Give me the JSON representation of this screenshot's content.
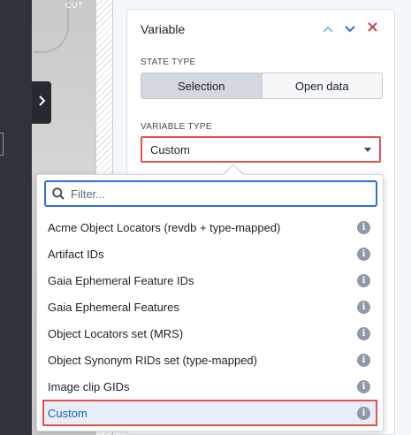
{
  "map": {
    "label": "CUT"
  },
  "panel": {
    "title": "Variable",
    "state_type": {
      "label": "STATE TYPE",
      "options": [
        "Selection",
        "Open data"
      ],
      "selected": "Selection"
    },
    "variable_type": {
      "label": "VARIABLE TYPE",
      "value": "Custom"
    }
  },
  "dropdown": {
    "filter_placeholder": "Filter...",
    "items": [
      {
        "label": "Acme Object Locators (revdb + type-mapped)",
        "info": "i"
      },
      {
        "label": "Artifact IDs",
        "info": "i"
      },
      {
        "label": "Gaia Ephemeral Feature IDs",
        "info": "i"
      },
      {
        "label": "Gaia Ephemeral Features",
        "info": "i"
      },
      {
        "label": "Object Locators set (MRS)",
        "info": "i"
      },
      {
        "label": "Object Synonym RIDs set (type-mapped)",
        "info": "i"
      },
      {
        "label": "Image clip GIDs",
        "info": "i"
      },
      {
        "label": "Custom",
        "info": "i"
      }
    ],
    "selected_index": 7
  },
  "colors": {
    "accent": "#2d72d2",
    "highlight_border": "#e5534b",
    "close": "#cd4246",
    "selected_bg": "#e7eef9"
  },
  "icons": {
    "collapse": "chevron-right-icon",
    "up": "chevron-up-icon",
    "down": "chevron-down-icon",
    "close": "close-icon",
    "search": "search-icon",
    "info": "info-icon"
  }
}
